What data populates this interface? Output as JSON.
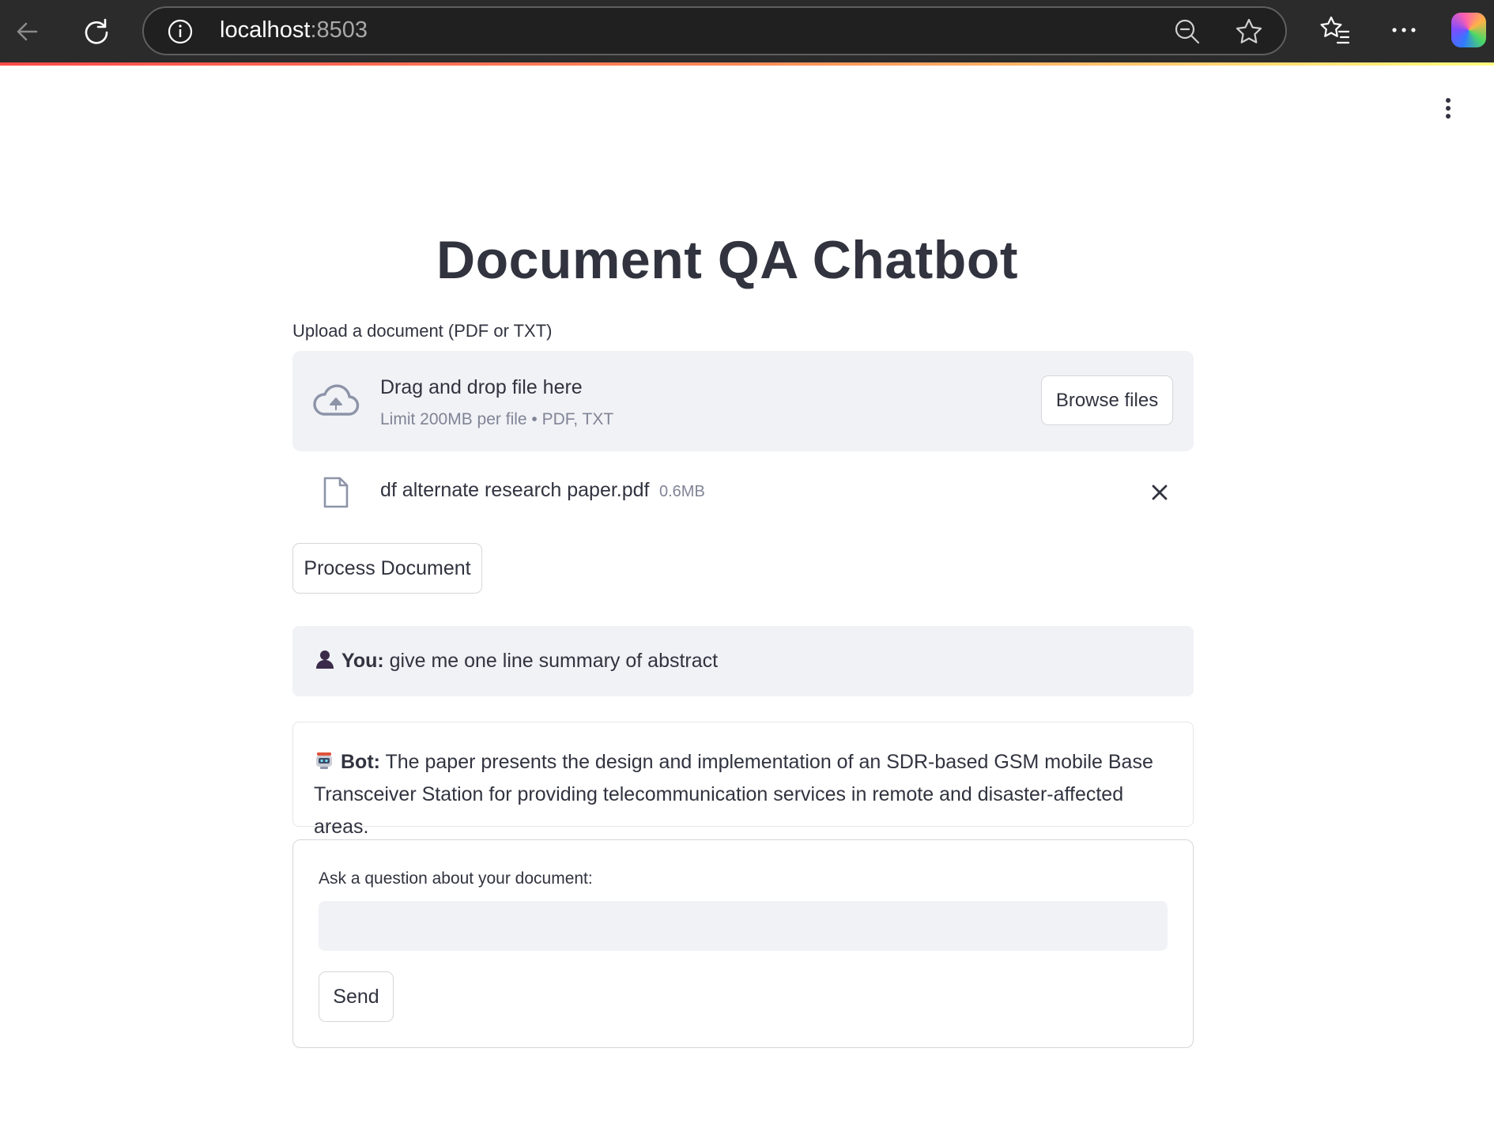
{
  "browser": {
    "url_host": "localhost",
    "url_port": ":8503",
    "icons": [
      "back-arrow-icon",
      "reload-icon",
      "info-icon",
      "zoom-out-icon",
      "favorite-star-icon",
      "favorites-list-icon",
      "more-icon",
      "copilot-icon"
    ]
  },
  "page": {
    "title": "Document QA Chatbot"
  },
  "uploader": {
    "label": "Upload a document (PDF or TXT)",
    "drop_title": "Drag and drop file here",
    "drop_subtitle": "Limit 200MB per file • PDF, TXT",
    "browse_label": "Browse files",
    "file": {
      "name": "df alternate research paper.pdf",
      "size": "0.6MB"
    }
  },
  "actions": {
    "process_label": "Process Document"
  },
  "chat": {
    "user": {
      "speaker": "You:",
      "text": " give me one line summary of abstract"
    },
    "bot": {
      "speaker": "Bot:",
      "text": " The paper presents the design and implementation of an SDR-based GSM mobile Base Transceiver Station for providing telecommunication services in remote and disaster-affected areas."
    }
  },
  "question_form": {
    "label": "Ask a question about your document:",
    "input_value": "",
    "send_label": "Send"
  },
  "colors": {
    "accent_red": "#ff4b4b",
    "panel_bg": "#f0f2f6",
    "text": "#31333f",
    "muted": "#808495"
  }
}
